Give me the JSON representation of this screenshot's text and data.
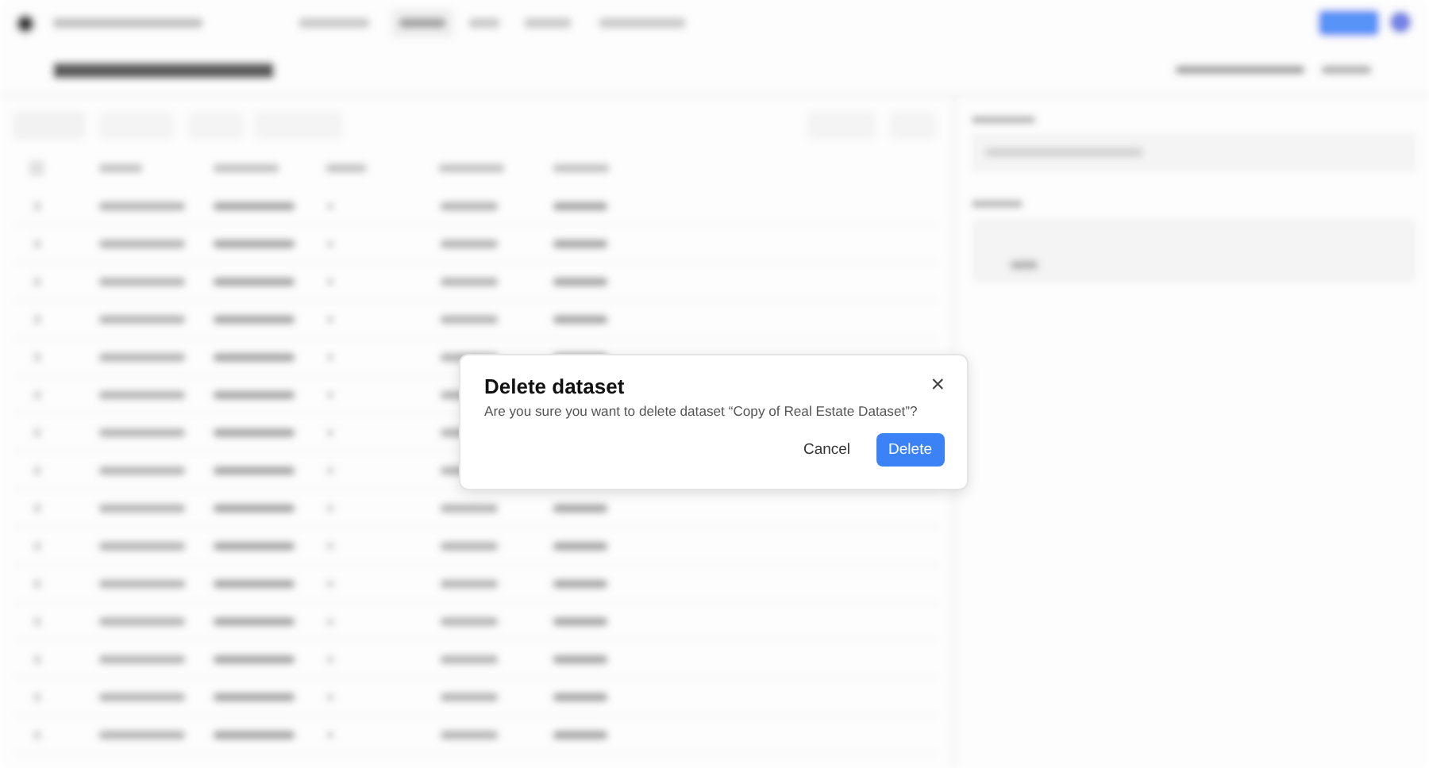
{
  "dialog": {
    "title": "Delete dataset",
    "message": "Are you sure you want to delete dataset “Copy of Real Estate Dataset”?",
    "close": "×",
    "buttons": [
      {
        "label": "Cancel",
        "kind": "secondary"
      },
      {
        "label": "Delete",
        "kind": "primary"
      }
    ]
  }
}
